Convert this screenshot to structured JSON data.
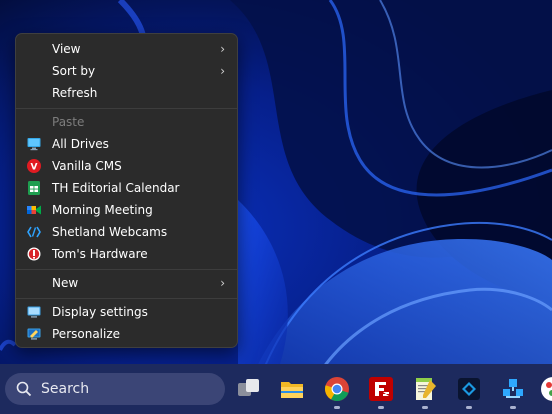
{
  "context_menu": {
    "view_label": "View",
    "sort_by_label": "Sort by",
    "refresh_label": "Refresh",
    "paste_label": "Paste",
    "shortcuts": [
      {
        "label": "All Drives",
        "icon": "monitor-icon"
      },
      {
        "label": "Vanilla CMS",
        "icon": "vanilla-v-icon"
      },
      {
        "label": "TH Editorial Calendar",
        "icon": "google-sheets-icon"
      },
      {
        "label": "Morning Meeting",
        "icon": "google-meet-icon"
      },
      {
        "label": "Shetland Webcams",
        "icon": "edge-link-icon"
      },
      {
        "label": "Tom's Hardware",
        "icon": "toms-hardware-icon"
      }
    ],
    "new_label": "New",
    "display_settings_label": "Display settings",
    "personalize_label": "Personalize",
    "vanilla_letter": "V"
  },
  "taskbar": {
    "search_label": "Search",
    "apps": [
      "task-view-icon",
      "file-explorer-icon",
      "chrome-icon",
      "filezilla-icon",
      "notepad-plus-plus-icon",
      "photo-editor-icon",
      "network-app-icon",
      "color-app-icon"
    ]
  },
  "colors": {
    "menu_bg": "#2b2b2b",
    "taskbar_bg": "#1d2a5e",
    "wallpaper_base": "#03134a",
    "accent_blue": "#2f6bff"
  }
}
